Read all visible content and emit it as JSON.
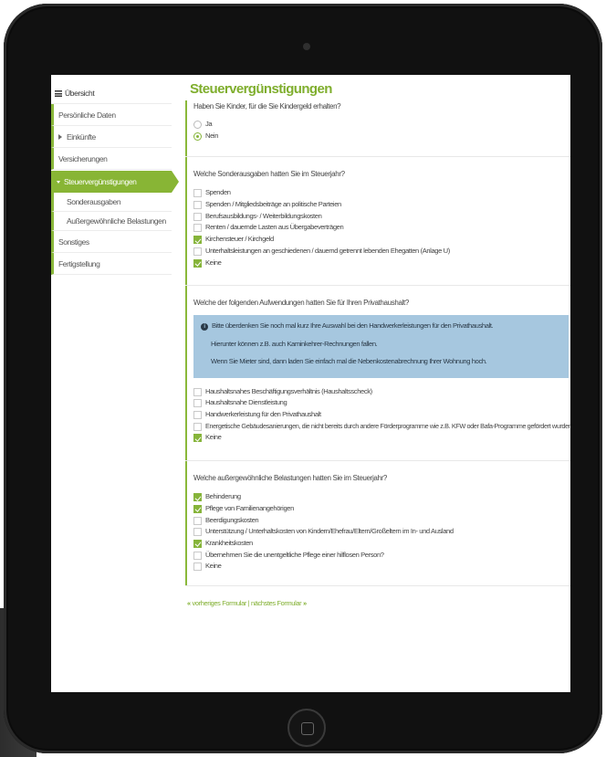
{
  "sidebar": {
    "overview": "Übersicht",
    "items": [
      {
        "label": "Persönliche Daten"
      },
      {
        "label": "Einkünfte"
      },
      {
        "label": "Versicherungen"
      },
      {
        "label": "Steuervergünstigungen"
      },
      {
        "label": "Sonderausgaben"
      },
      {
        "label": "Außergewöhnliche Belastungen"
      },
      {
        "label": "Sonstiges"
      },
      {
        "label": "Fertigstellung"
      }
    ]
  },
  "main": {
    "title": "Steuervergünstigungen",
    "kindergeld": {
      "question": "Haben Sie Kinder, für die Sie Kindergeld erhalten?",
      "options": [
        {
          "label": "Ja",
          "selected": false
        },
        {
          "label": "Nein",
          "selected": true
        }
      ]
    },
    "sonderausgaben": {
      "question": "Welche Sonderausgaben hatten Sie im Steuerjahr?",
      "options": [
        {
          "label": "Spenden",
          "checked": false
        },
        {
          "label": "Spenden / Mitgliedsbeiträge an politische Parteien",
          "checked": false
        },
        {
          "label": "Berufsausbildungs- / Weiterbildungskosten",
          "checked": false
        },
        {
          "label": "Renten / dauernde Lasten aus Übergabeverträgen",
          "checked": false
        },
        {
          "label": "Kirchensteuer / Kirchgeld",
          "checked": true
        },
        {
          "label": "Unterhaltsleistungen an geschiedenen / dauernd getrennt lebenden Ehegatten (Anlage U)",
          "checked": false
        },
        {
          "label": "Keine",
          "checked": true
        }
      ]
    },
    "privathaushalt": {
      "question": "Welche der folgenden Aufwendungen hatten Sie für Ihren Privathaushalt?",
      "info": {
        "line1": "Bitte überdenken Sie noch mal kurz Ihre Auswahl bei den Handwerkerleistungen für den Privathaushalt.",
        "line2": "Hierunter können z.B. auch Kaminkehrer-Rechnungen fallen.",
        "line3": "Wenn Sie Mieter sind, dann laden Sie einfach mal die Nebenkostenabrechnung Ihrer Wohnung hoch."
      },
      "options": [
        {
          "label": "Haushaltsnahes Beschäftigungsverhältnis (Haushaltsscheck)",
          "checked": false
        },
        {
          "label": "Haushaltsnahe Dienstleistung",
          "checked": false
        },
        {
          "label": "Handwerkerleistung für den Privathaushalt",
          "checked": false
        },
        {
          "label": "Energetische Gebäudesanierungen, die nicht bereits durch andere Förderprogramme wie z.B. KFW oder Bafa-Programme gefördert wurden",
          "checked": false
        },
        {
          "label": "Keine",
          "checked": true
        }
      ]
    },
    "belastungen": {
      "question": "Welche außergewöhnliche Belastungen hatten Sie im Steuerjahr?",
      "options": [
        {
          "label": "Behinderung",
          "checked": true
        },
        {
          "label": "Pflege von Familienangehörigen",
          "checked": true
        },
        {
          "label": "Beerdigungskosten",
          "checked": false
        },
        {
          "label": "Unterstützung / Unterhaltskosten von Kindern/Ehefrau/Eltern/Großeltern im In- und Ausland",
          "checked": false
        },
        {
          "label": "Krankheitskosten",
          "checked": true
        },
        {
          "label": "Übernehmen Sie die unentgeltliche Pflege einer hilflosen Person?",
          "checked": false
        },
        {
          "label": "Keine",
          "checked": false
        }
      ]
    },
    "footer": {
      "prev_arrow": "«",
      "prev": "vorheriges Formular",
      "separator": "|",
      "next": "nächstes Formular",
      "next_arrow": "»"
    }
  },
  "colors": {
    "accent": "#88b535",
    "info_bg": "#a6c7df",
    "frame": "#111111"
  }
}
